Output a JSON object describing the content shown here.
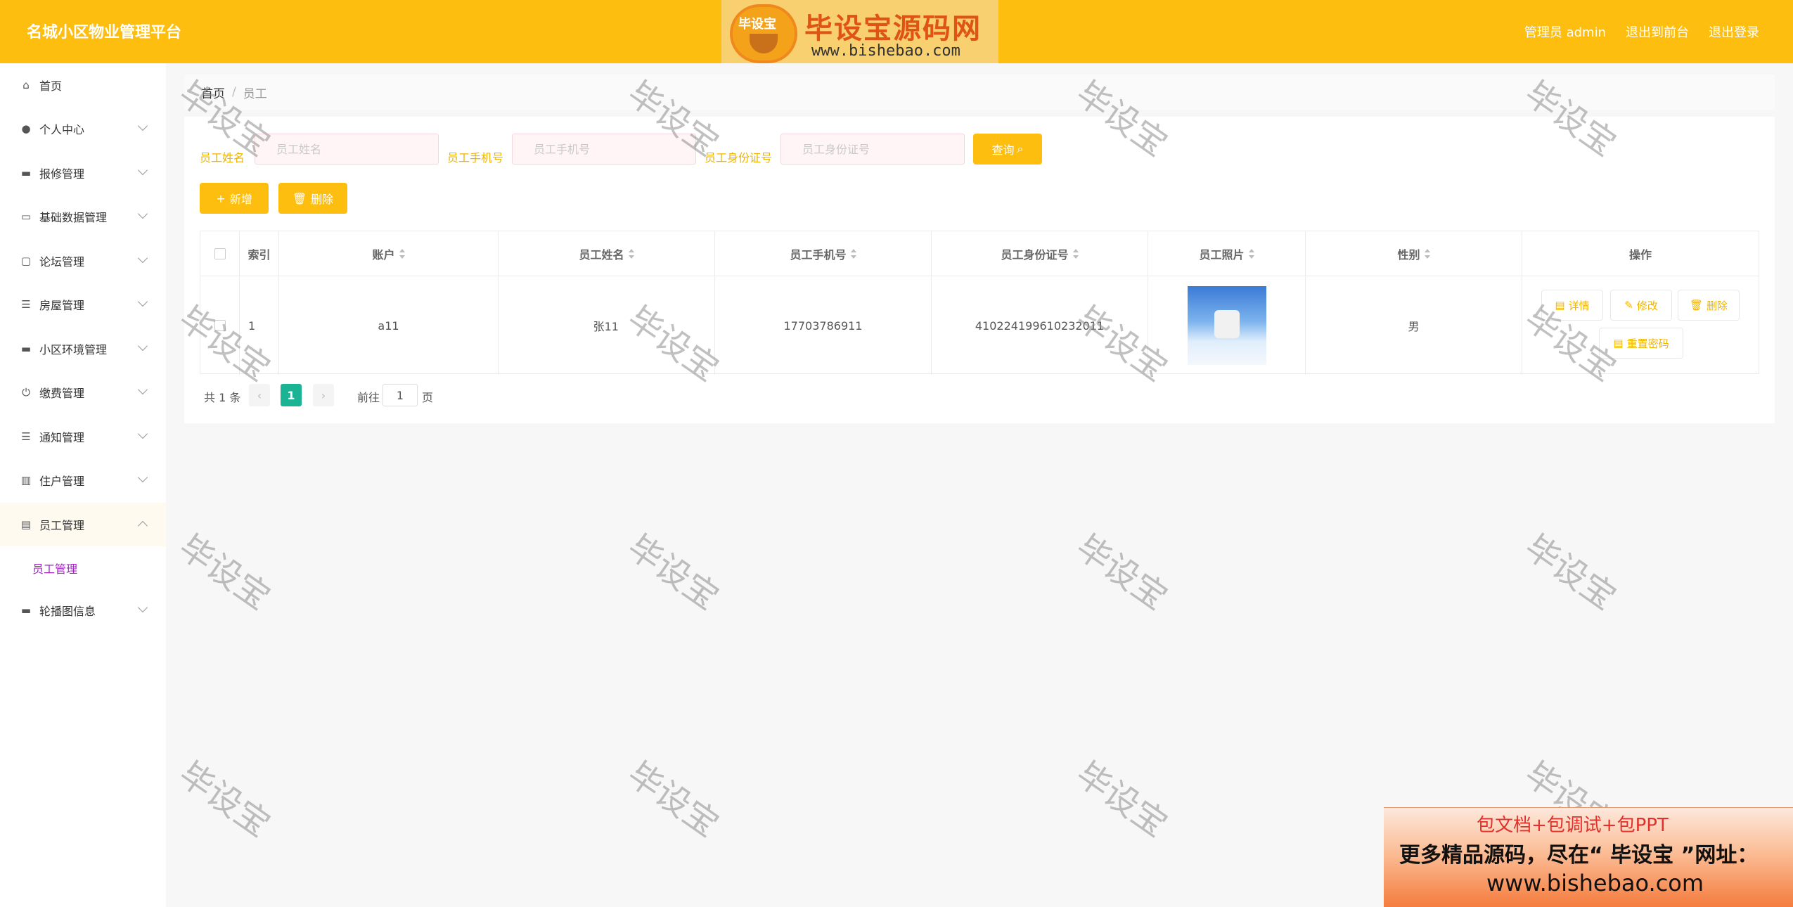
{
  "header": {
    "app_title": "名城小区物业管理平台",
    "admin_label": "管理员 admin",
    "frontend_link": "退出到前台",
    "logout_link": "退出登录",
    "logo_badge": "毕设宝",
    "logo_title": "毕设宝源码网",
    "logo_url": "www.bishebao.com",
    "color": "#fdbe10"
  },
  "sidebar": {
    "items": [
      {
        "label": "首页",
        "icon": "home-icon"
      },
      {
        "label": "个人中心",
        "icon": "user-icon"
      },
      {
        "label": "报修管理",
        "icon": "tools-icon"
      },
      {
        "label": "基础数据管理",
        "icon": "monitor-icon"
      },
      {
        "label": "论坛管理",
        "icon": "chat-icon"
      },
      {
        "label": "房屋管理",
        "icon": "list-icon"
      },
      {
        "label": "小区环境管理",
        "icon": "message-icon"
      },
      {
        "label": "缴费管理",
        "icon": "power-icon"
      },
      {
        "label": "通知管理",
        "icon": "list-icon"
      },
      {
        "label": "住户管理",
        "icon": "chart-icon"
      },
      {
        "label": "员工管理",
        "icon": "id-card-icon"
      },
      {
        "label": "轮播图信息",
        "icon": "picture-icon"
      }
    ],
    "submenu_label": "员工管理"
  },
  "breadcrumb": {
    "home": "首页",
    "separator": "/",
    "current": "员工"
  },
  "search": {
    "name_label": "员工姓名",
    "name_placeholder": "员工姓名",
    "phone_label": "员工手机号",
    "phone_placeholder": "员工手机号",
    "idcard_label": "员工身份证号",
    "idcard_placeholder": "员工身份证号",
    "query_label": "查询"
  },
  "actions": {
    "add_label": "新增",
    "delete_label": "删除"
  },
  "table": {
    "columns": [
      "索引",
      "账户",
      "员工姓名",
      "员工手机号",
      "员工身份证号",
      "员工照片",
      "性别",
      "操作"
    ],
    "rows": [
      {
        "index": "1",
        "account": "a11",
        "name": "张11",
        "phone": "17703786911",
        "idcard": "410224199610232011",
        "gender": "男"
      }
    ],
    "ops": {
      "detail": "详情",
      "edit": "修改",
      "delete": "删除",
      "reset": "重置密码"
    }
  },
  "pagination": {
    "total": "共 1 条",
    "prev": "‹",
    "current": "1",
    "next": "›",
    "goto_prefix": "前往",
    "goto_value": "1",
    "goto_suffix": "页"
  },
  "watermark": "毕设宝",
  "ad": {
    "line1": "包文档+包调试+包PPT",
    "line2": "更多精品源码，尽在“ 毕设宝 ”网址：",
    "line3": "www.bishebao.com"
  }
}
